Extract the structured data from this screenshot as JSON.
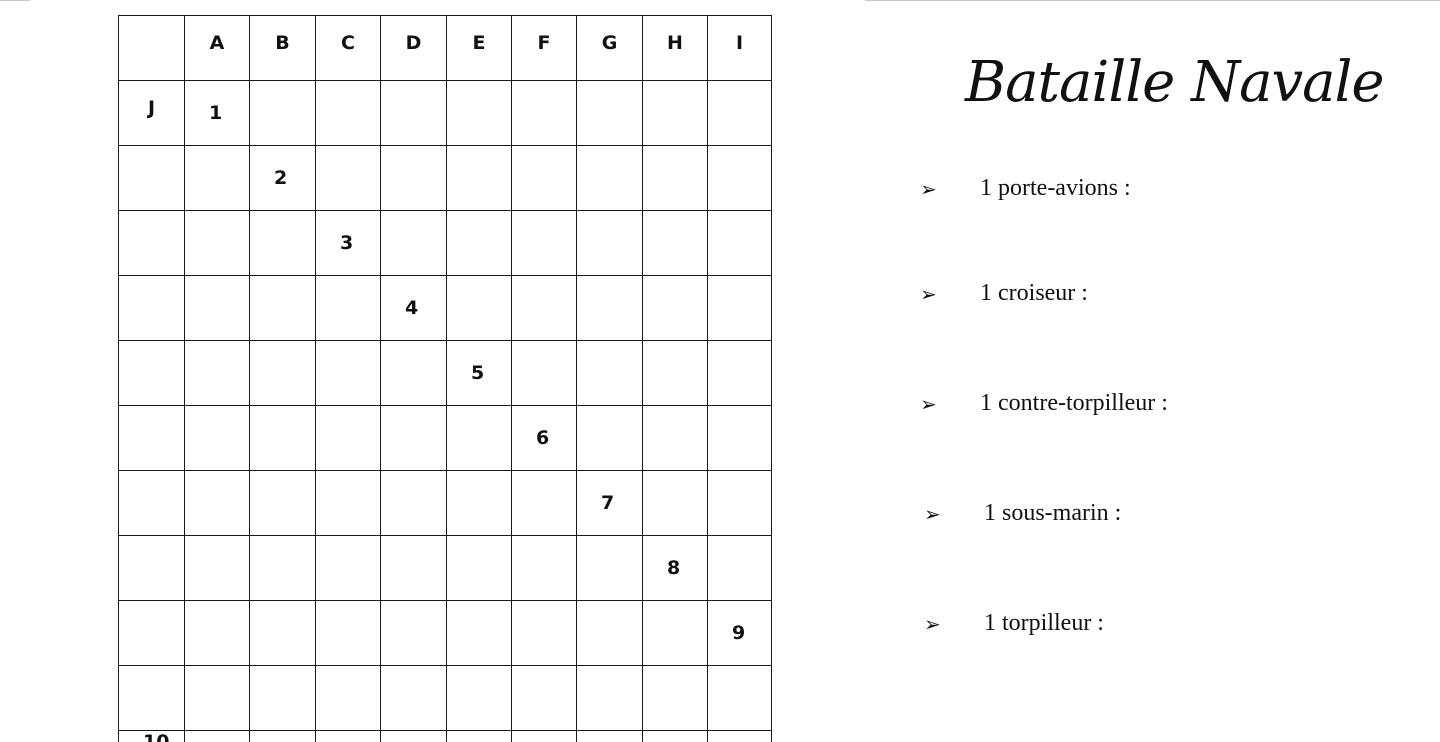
{
  "title": "Bataille Navale",
  "board": {
    "columns": [
      "A",
      "B",
      "C",
      "D",
      "E",
      "F",
      "G",
      "H",
      "I",
      "J"
    ],
    "rows": [
      "1",
      "2",
      "3",
      "4",
      "5",
      "6",
      "7",
      "8",
      "9",
      "10"
    ]
  },
  "ships": [
    {
      "label": "1 porte-avions :",
      "icon": "arrow-bullet-icon"
    },
    {
      "label": "1 croiseur :",
      "icon": "arrow-bullet-icon"
    },
    {
      "label": "1 contre-torpilleur :",
      "icon": "arrow-bullet-icon"
    },
    {
      "label": "1 sous-marin :",
      "icon": "arrow-bullet-icon"
    },
    {
      "label": "1 torpilleur :",
      "icon": "arrow-bullet-icon"
    }
  ]
}
